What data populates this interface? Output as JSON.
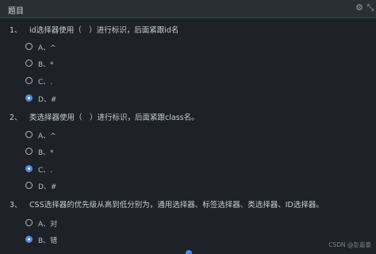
{
  "header": {
    "title": "题目",
    "settings_icon": "gear-icon",
    "collapse_icon": "collapse-icon"
  },
  "questions": [
    {
      "num": "1、",
      "text": "id选择器使用（　）进行标识，后面紧跟id名",
      "options": [
        {
          "label": "A、^",
          "checked": false
        },
        {
          "label": "B、*",
          "checked": false
        },
        {
          "label": "C、.",
          "checked": false
        },
        {
          "label": "D、#",
          "checked": true
        }
      ]
    },
    {
      "num": "2、",
      "text": "类选择器使用（　）进行标识，后面紧跟class名。",
      "options": [
        {
          "label": "A、^",
          "checked": false
        },
        {
          "label": "B、*",
          "checked": false
        },
        {
          "label": "C、.",
          "checked": true
        },
        {
          "label": "D、#",
          "checked": false
        }
      ]
    },
    {
      "num": "3、",
      "text": "CSS选择器的优先级从高到低分别为，通用选择器、标签选择器、类选择器、ID选择器。",
      "options": [
        {
          "label": "A、对",
          "checked": false
        },
        {
          "label": "B、错",
          "checked": true
        }
      ]
    }
  ],
  "watermark": "CSDN @彭嘉豪",
  "colors": {
    "accent": "#4d86e8",
    "background": "#1e2228"
  }
}
